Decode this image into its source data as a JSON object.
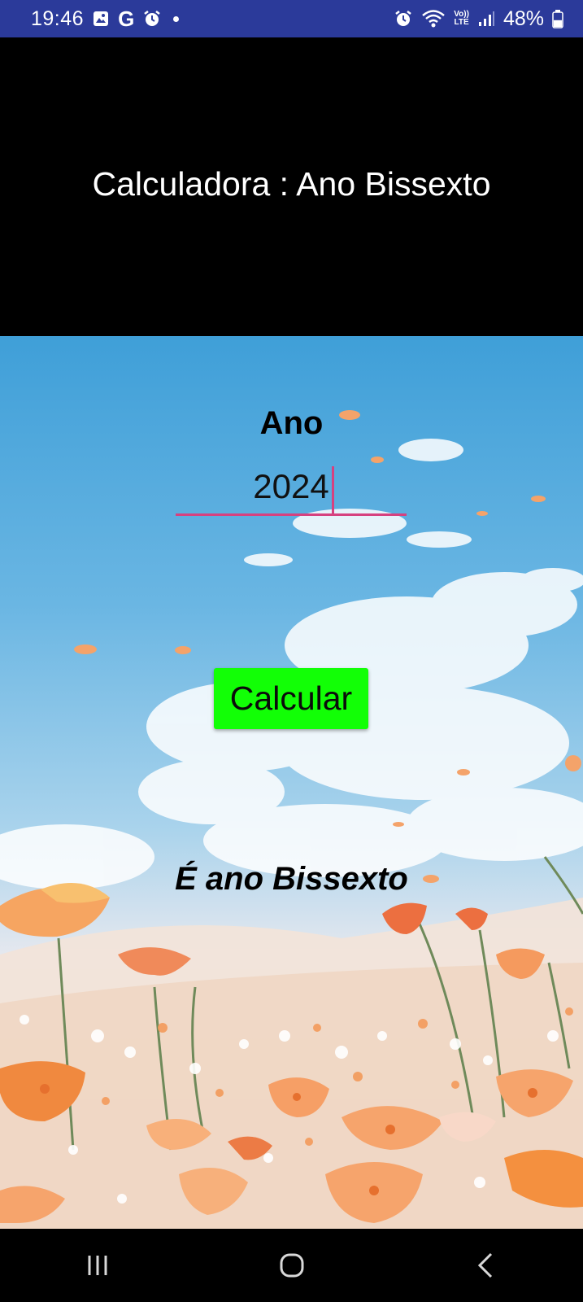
{
  "status_bar": {
    "time": "19:46",
    "left_icons": [
      "gallery-icon",
      "google-icon",
      "alarm-icon",
      "notification-dot"
    ],
    "google_letter": "G",
    "right_icons": [
      "alarm-icon",
      "wifi-icon",
      "volte-icon",
      "signal-icon",
      "battery-icon"
    ],
    "volte_label_top": "Vo))",
    "volte_label_bottom": "LTE",
    "battery_percent": "48%",
    "battery_level": 0.48
  },
  "header": {
    "title": "Calculadora : Ano Bissexto"
  },
  "form": {
    "label": "Ano",
    "input_value": "2024",
    "button_label": "Calcular",
    "result": "É ano Bissexto"
  },
  "nav_bar": {
    "buttons": [
      "recents-icon",
      "home-icon",
      "back-icon"
    ]
  },
  "colors": {
    "status_bar": "#2b3a9a",
    "header_bg": "#000000",
    "button_bg": "#12ff06",
    "input_accent": "#d6417f",
    "sky_top": "#3f9fd8",
    "flower": "#f39a5a"
  }
}
